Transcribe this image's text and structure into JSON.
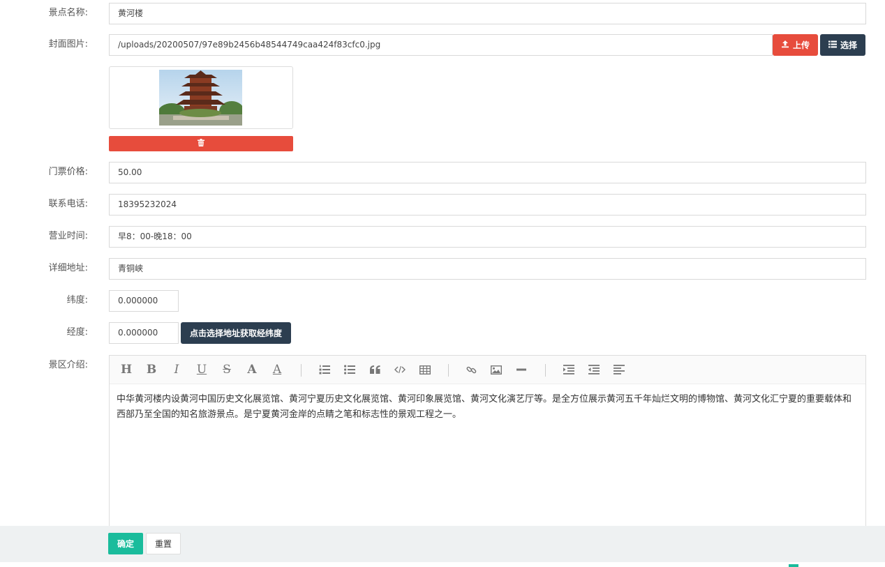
{
  "form": {
    "name": {
      "label": "景点名称:",
      "value": "黄河楼"
    },
    "cover": {
      "label": "封面图片:",
      "value": "/uploads/20200507/97e89b2456b48544749caa424f83cfc0.jpg",
      "upload_label": "上传",
      "choose_label": "选择"
    },
    "price": {
      "label": "门票价格:",
      "value": "50.00"
    },
    "phone": {
      "label": "联系电话:",
      "value": "18395232024"
    },
    "hours": {
      "label": "营业时间:",
      "value": "早8：00-晚18：00"
    },
    "address": {
      "label": "详细地址:",
      "value": "青铜峡"
    },
    "latitude": {
      "label": "纬度:",
      "value": "0.000000"
    },
    "longitude": {
      "label": "经度:",
      "value": "0.000000",
      "pick_button": "点击选择地址获取经纬度"
    },
    "intro": {
      "label": "景区介绍:",
      "content": "中华黄河楼内设黄河中国历史文化展览馆、黄河宁夏历史文化展览馆、黄河印象展览馆、黄河文化演艺厅等。是全方位展示黄河五千年灿烂文明的博物馆、黄河文化汇宁夏的重要载体和西部乃至全国的知名旅游景点。是宁夏黄河金岸的点睛之笔和标志性的景观工程之一。",
      "toolbar": {
        "heading": "H",
        "bold": "B",
        "italic": "I",
        "underline": "U",
        "strike": "S",
        "font_size": "A",
        "font_color": "A"
      }
    }
  },
  "footer": {
    "confirm_label": "确定",
    "reset_label": "重置"
  },
  "colors": {
    "danger": "#e74c3c",
    "dark": "#2c3e50",
    "primary": "#1abc9c"
  }
}
